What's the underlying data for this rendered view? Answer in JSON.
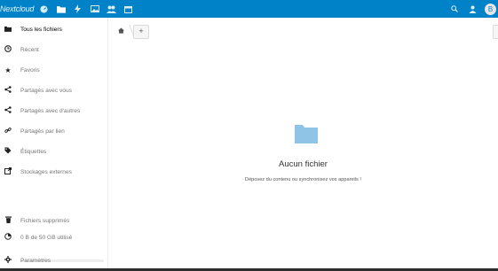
{
  "header": {
    "logo_text": "Nextcloud",
    "apps": [
      {
        "name": "dashboard-icon",
        "glyph": "◔"
      },
      {
        "name": "files-icon",
        "glyph": "■"
      },
      {
        "name": "activity-icon",
        "glyph": "ϟ"
      },
      {
        "name": "photos-icon",
        "glyph": "▨"
      },
      {
        "name": "contacts-icon",
        "glyph": "👥"
      },
      {
        "name": "calendar-icon",
        "glyph": "▦"
      }
    ],
    "avatar_initial": "B",
    "accent_color": "#0082c9"
  },
  "sidebar": {
    "items": [
      {
        "label": "Tous les fichiers",
        "icon": "folder-icon"
      },
      {
        "label": "Récent",
        "icon": "clock-icon"
      },
      {
        "label": "Favoris",
        "icon": "star-icon"
      },
      {
        "label": "Partagés avec vous",
        "icon": "share-icon"
      },
      {
        "label": "Partagés avec d'autres",
        "icon": "share-icon"
      },
      {
        "label": "Partagés par lien",
        "icon": "link-icon"
      },
      {
        "label": "Étiquettes",
        "icon": "tag-icon"
      },
      {
        "label": "Stockages externes",
        "icon": "external-icon"
      }
    ],
    "trash_label": "Fichiers supprimés",
    "quota_label": "0 B de 50 GB utilisé",
    "quota_fraction": 0,
    "settings_label": "Paramètres"
  },
  "main": {
    "add_label": "+",
    "empty_title": "Aucun fichier",
    "empty_subtitle": "Déposez du contenu ou synchronisez vos appareils !"
  }
}
